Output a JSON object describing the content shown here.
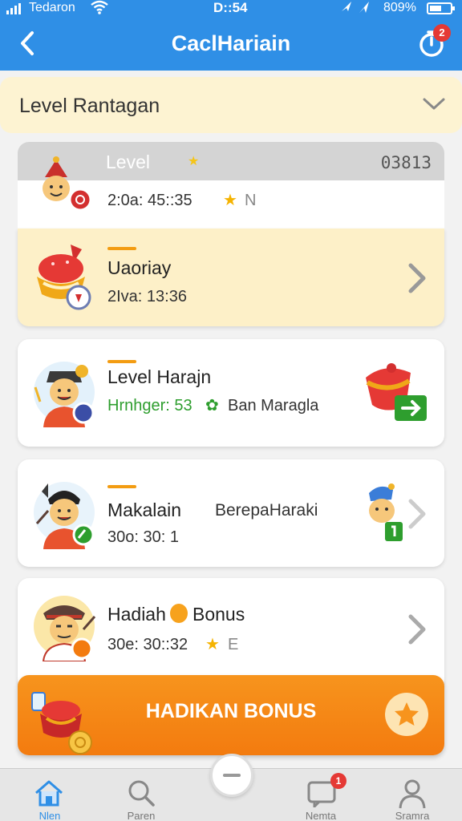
{
  "status_bar": {
    "carrier": "Tedaron",
    "time": "D::54",
    "battery": "809%"
  },
  "header": {
    "title": "CaclHariain",
    "timer_badge": "2"
  },
  "level_select": {
    "label": "Level Rantagan"
  },
  "level_header": {
    "label": "Level",
    "code": "03813",
    "avatar_time": "2:0a: 45::35",
    "suffix": "N"
  },
  "rows": [
    {
      "title": "Uaoriay",
      "sub": "2Iva: 13:36"
    },
    {
      "title": "Level Harajn",
      "sub_green": "Hrnhger: 53",
      "sub_rest": "Ban Maragla"
    },
    {
      "title": "Makalain",
      "title_rest": "BerepaHaraki",
      "sub": "30o: 30: 1"
    },
    {
      "title": "Hadiah",
      "title_rest": "Bonus",
      "sub": "30e: 30::32",
      "suffix": "E"
    }
  ],
  "bonus_button": {
    "label": "HADIKAN BONUS"
  },
  "tabs": [
    {
      "label": "Nlen",
      "icon": "home-icon"
    },
    {
      "label": "Paren",
      "icon": "search-icon"
    },
    {
      "label": "",
      "icon": "minus-icon"
    },
    {
      "label": "Nemta",
      "icon": "chat-icon",
      "badge": "1"
    },
    {
      "label": "Sramra",
      "icon": "person-icon"
    }
  ],
  "colors": {
    "primary": "#2f8fe6",
    "accent": "#f7941d",
    "highlight": "#fdf0c8",
    "green": "#2e9e2e"
  }
}
